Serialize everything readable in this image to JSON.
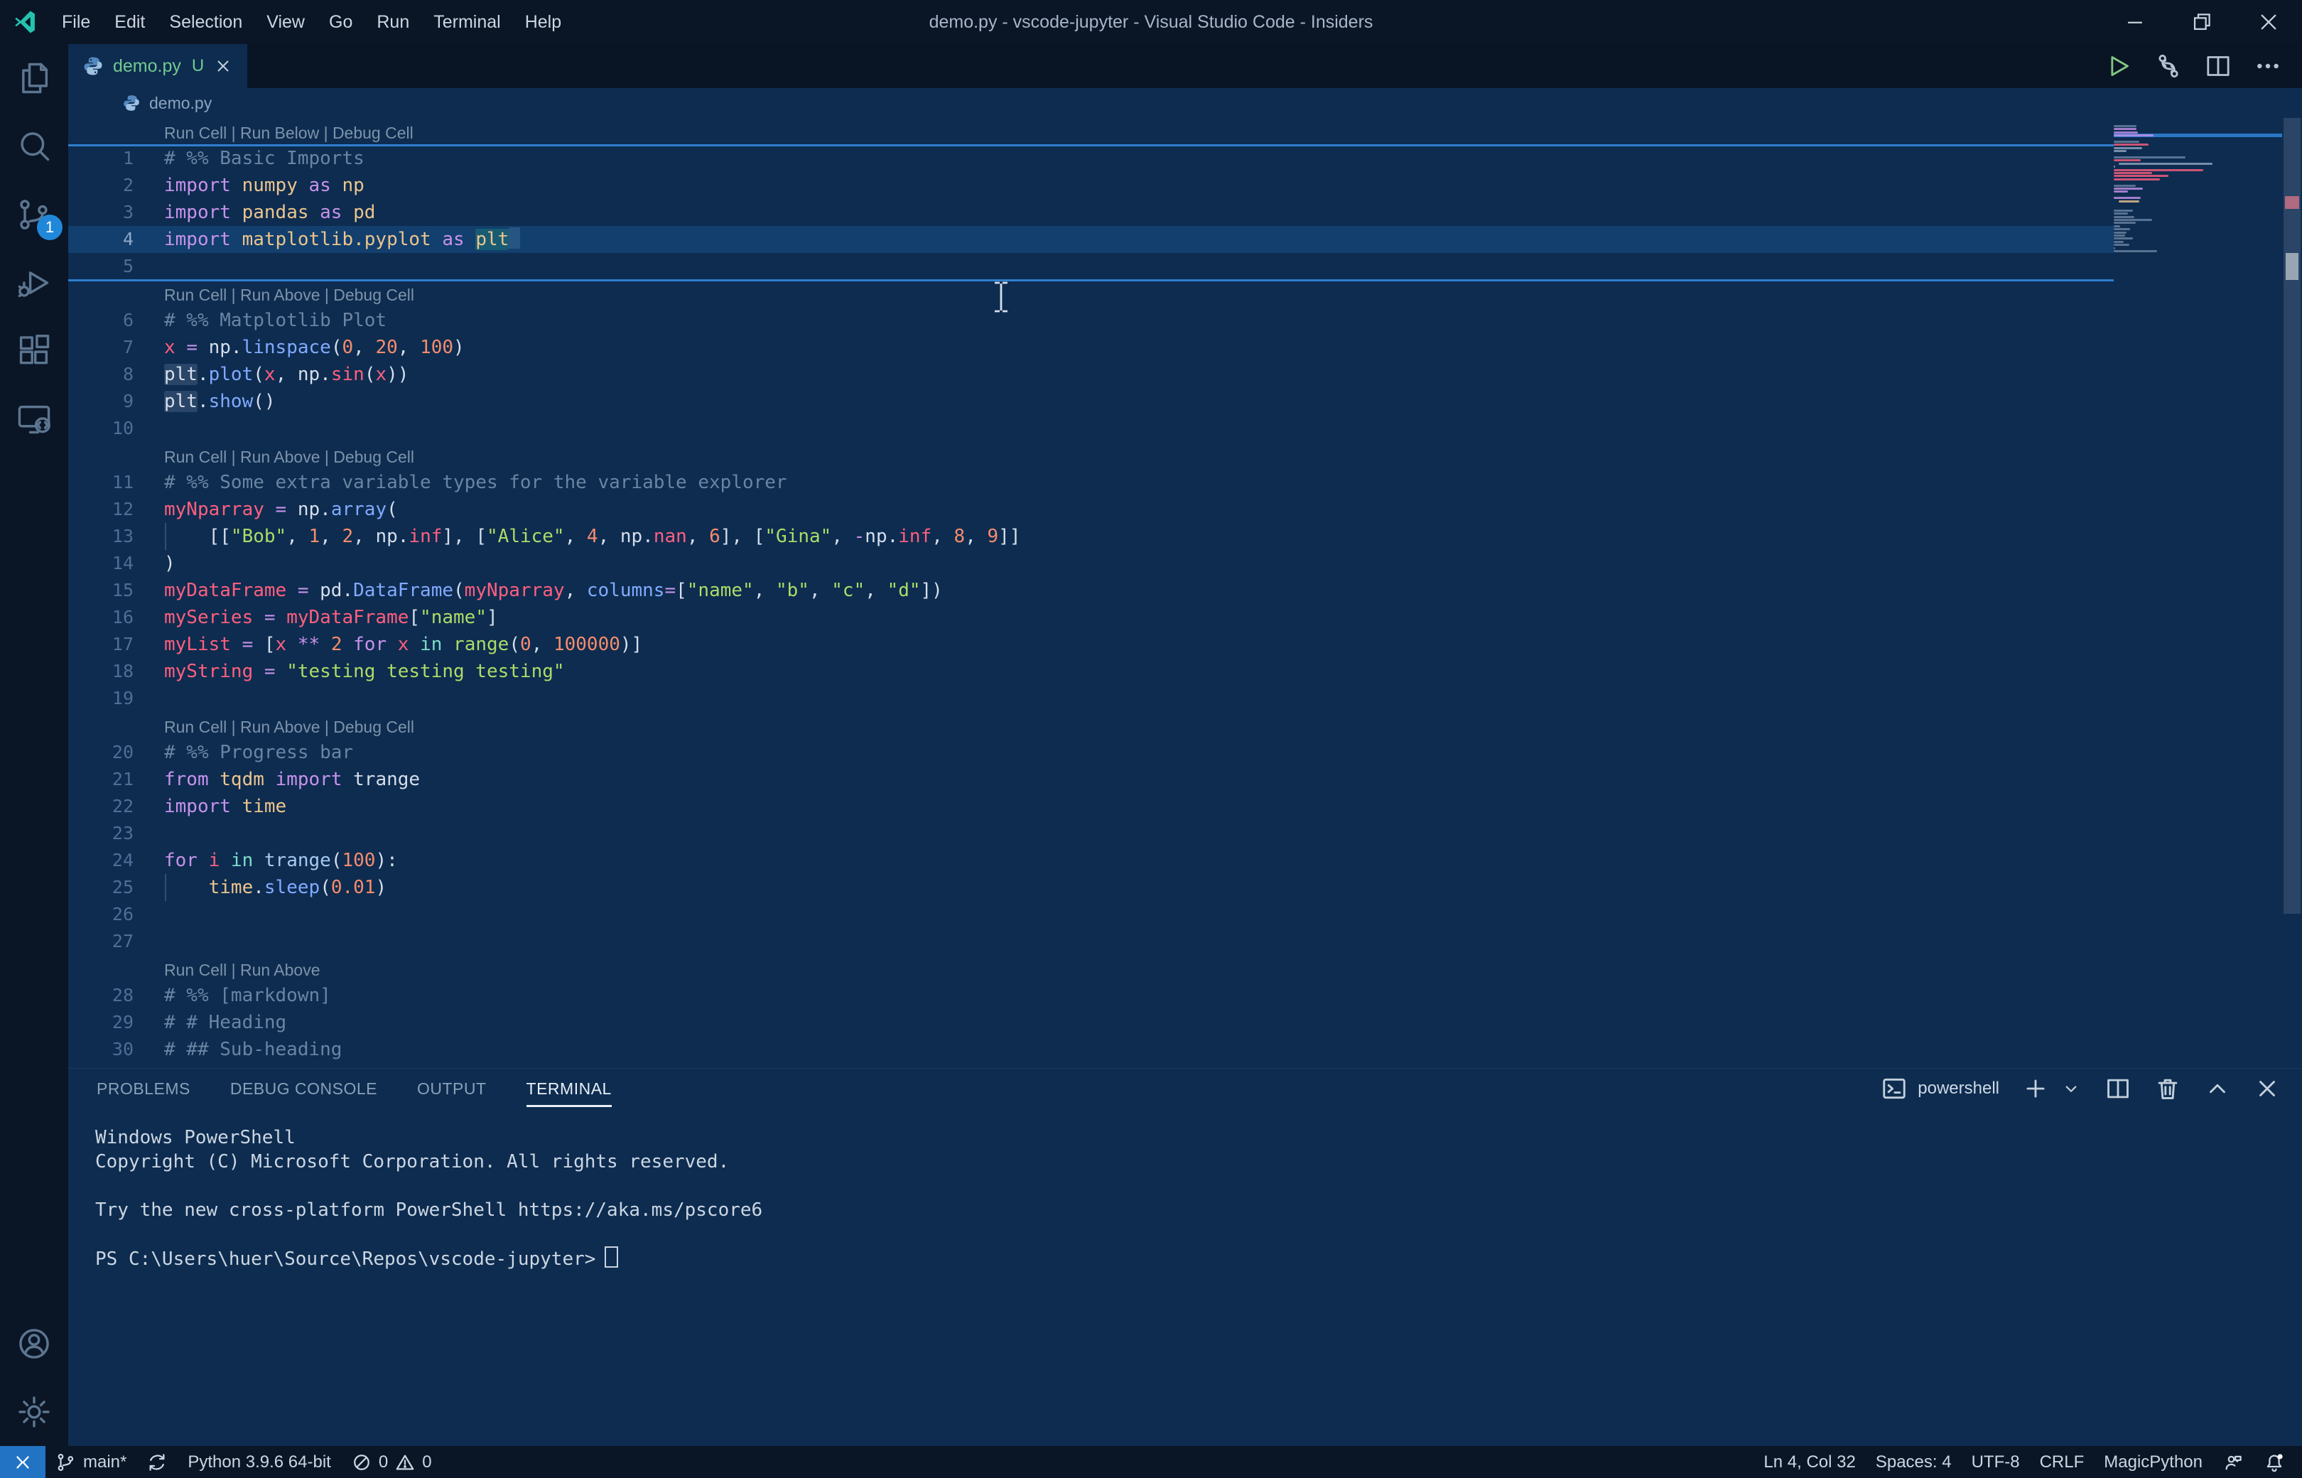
{
  "window": {
    "title": "demo.py - vscode-jupyter - Visual Studio Code - Insiders",
    "menus": [
      "File",
      "Edit",
      "Selection",
      "View",
      "Go",
      "Run",
      "Terminal",
      "Help"
    ]
  },
  "activity_bar": {
    "source_control_badge": "1"
  },
  "editor_tabs": {
    "active_tab": {
      "label": "demo.py",
      "modified_indicator": "U"
    }
  },
  "breadcrumb": {
    "file": "demo.py"
  },
  "editor": {
    "rows": [
      {
        "type": "lens",
        "text": "Run Cell | Run Below | Debug Cell"
      },
      {
        "type": "divider"
      },
      {
        "type": "code",
        "num": "1",
        "tokens": [
          [
            "cm",
            "# %% Basic Imports"
          ]
        ]
      },
      {
        "type": "code",
        "num": "2",
        "tokens": [
          [
            "kw",
            "import"
          ],
          [
            "pl",
            " "
          ],
          [
            "md",
            "numpy"
          ],
          [
            "pl",
            " "
          ],
          [
            "kw",
            "as"
          ],
          [
            "pl",
            " "
          ],
          [
            "md",
            "np"
          ]
        ]
      },
      {
        "type": "code",
        "num": "3",
        "tokens": [
          [
            "kw",
            "import"
          ],
          [
            "pl",
            " "
          ],
          [
            "md",
            "pandas"
          ],
          [
            "pl",
            " "
          ],
          [
            "kw",
            "as"
          ],
          [
            "pl",
            " "
          ],
          [
            "md",
            "pd"
          ]
        ]
      },
      {
        "type": "code",
        "num": "4",
        "hl": true,
        "tokens": [
          [
            "kw",
            "import"
          ],
          [
            "pl",
            " "
          ],
          [
            "md",
            "matplotlib.pyplot"
          ],
          [
            "pl",
            " "
          ],
          [
            "kw",
            "as"
          ],
          [
            "pl",
            " "
          ],
          [
            "md sel",
            "plt"
          ],
          [
            "cur",
            ""
          ]
        ]
      },
      {
        "type": "code",
        "num": "5",
        "tokens": []
      },
      {
        "type": "divider"
      },
      {
        "type": "lens",
        "text": "Run Cell | Run Above | Debug Cell"
      },
      {
        "type": "code",
        "num": "6",
        "tokens": [
          [
            "cm",
            "# %% Matplotlib Plot"
          ]
        ]
      },
      {
        "type": "code",
        "num": "7",
        "tokens": [
          [
            "vr",
            "x"
          ],
          [
            "pl",
            " "
          ],
          [
            "kw",
            "="
          ],
          [
            "pl",
            " np."
          ],
          [
            "fn",
            "linspace"
          ],
          [
            "pl",
            "("
          ],
          [
            "nm",
            "0"
          ],
          [
            "pl",
            ", "
          ],
          [
            "nm",
            "20"
          ],
          [
            "pl",
            ", "
          ],
          [
            "nm",
            "100"
          ],
          [
            "pl",
            ")"
          ]
        ]
      },
      {
        "type": "code",
        "num": "8",
        "tokens": [
          [
            "pl occ",
            "plt"
          ],
          [
            "pl",
            "."
          ],
          [
            "fn",
            "plot"
          ],
          [
            "pl",
            "("
          ],
          [
            "vr",
            "x"
          ],
          [
            "pl",
            ", np."
          ],
          [
            "vr",
            "sin"
          ],
          [
            "pl",
            "("
          ],
          [
            "vr",
            "x"
          ],
          [
            "pl",
            "))"
          ]
        ]
      },
      {
        "type": "code",
        "num": "9",
        "tokens": [
          [
            "pl occ",
            "plt"
          ],
          [
            "pl",
            "."
          ],
          [
            "fn",
            "show"
          ],
          [
            "pl",
            "()"
          ]
        ]
      },
      {
        "type": "code",
        "num": "10",
        "tokens": []
      },
      {
        "type": "lens",
        "text": "Run Cell | Run Above | Debug Cell"
      },
      {
        "type": "code",
        "num": "11",
        "tokens": [
          [
            "cm",
            "# %% Some extra variable types for the variable explorer"
          ]
        ]
      },
      {
        "type": "code",
        "num": "12",
        "tokens": [
          [
            "vr",
            "myNparray"
          ],
          [
            "pl",
            " "
          ],
          [
            "kw",
            "="
          ],
          [
            "pl",
            " np."
          ],
          [
            "fn",
            "array"
          ],
          [
            "pl",
            "("
          ]
        ]
      },
      {
        "type": "code",
        "num": "13",
        "guide": true,
        "tokens": [
          [
            "pl",
            "    [["
          ],
          [
            "st",
            "\"Bob\""
          ],
          [
            "pl",
            ", "
          ],
          [
            "nm",
            "1"
          ],
          [
            "pl",
            ", "
          ],
          [
            "nm",
            "2"
          ],
          [
            "pl",
            ", np."
          ],
          [
            "vr",
            "inf"
          ],
          [
            "pl",
            "], ["
          ],
          [
            "st",
            "\"Alice\""
          ],
          [
            "pl",
            ", "
          ],
          [
            "nm",
            "4"
          ],
          [
            "pl",
            ", np."
          ],
          [
            "vr",
            "nan"
          ],
          [
            "pl",
            ", "
          ],
          [
            "nm",
            "6"
          ],
          [
            "pl",
            "], ["
          ],
          [
            "st",
            "\"Gina\""
          ],
          [
            "pl",
            ", "
          ],
          [
            "kw",
            "-"
          ],
          [
            "pl",
            "np."
          ],
          [
            "vr",
            "inf"
          ],
          [
            "pl",
            ", "
          ],
          [
            "nm",
            "8"
          ],
          [
            "pl",
            ", "
          ],
          [
            "nm",
            "9"
          ],
          [
            "pl",
            "]]"
          ]
        ]
      },
      {
        "type": "code",
        "num": "14",
        "tokens": [
          [
            "pl",
            ")"
          ]
        ]
      },
      {
        "type": "code",
        "num": "15",
        "tokens": [
          [
            "vr",
            "myDataFrame"
          ],
          [
            "pl",
            " "
          ],
          [
            "kw",
            "="
          ],
          [
            "pl",
            " pd."
          ],
          [
            "fn",
            "DataFrame"
          ],
          [
            "pl",
            "("
          ],
          [
            "vr",
            "myNparray"
          ],
          [
            "pl",
            ", "
          ],
          [
            "fn",
            "columns"
          ],
          [
            "kw",
            "="
          ],
          [
            "pl",
            "["
          ],
          [
            "st",
            "\"name\""
          ],
          [
            "pl",
            ", "
          ],
          [
            "st",
            "\"b\""
          ],
          [
            "pl",
            ", "
          ],
          [
            "st",
            "\"c\""
          ],
          [
            "pl",
            ", "
          ],
          [
            "st",
            "\"d\""
          ],
          [
            "pl",
            "])"
          ]
        ]
      },
      {
        "type": "code",
        "num": "16",
        "tokens": [
          [
            "vr",
            "mySeries"
          ],
          [
            "pl",
            " "
          ],
          [
            "kw",
            "="
          ],
          [
            "pl",
            " "
          ],
          [
            "vr",
            "myDataFrame"
          ],
          [
            "pl",
            "["
          ],
          [
            "st",
            "\"name\""
          ],
          [
            "pl",
            "]"
          ]
        ]
      },
      {
        "type": "code",
        "num": "17",
        "tokens": [
          [
            "vr",
            "myList"
          ],
          [
            "pl",
            " "
          ],
          [
            "kw",
            "="
          ],
          [
            "pl",
            " ["
          ],
          [
            "vr",
            "x"
          ],
          [
            "pl",
            " "
          ],
          [
            "kw",
            "**"
          ],
          [
            "pl",
            " "
          ],
          [
            "nm",
            "2"
          ],
          [
            "pl",
            " "
          ],
          [
            "kw",
            "for"
          ],
          [
            "pl",
            " "
          ],
          [
            "vr",
            "x"
          ],
          [
            "pl",
            " "
          ],
          [
            "cy",
            "in"
          ],
          [
            "pl",
            " "
          ],
          [
            "bi",
            "range"
          ],
          [
            "pl",
            "("
          ],
          [
            "nm",
            "0"
          ],
          [
            "pl",
            ", "
          ],
          [
            "nm",
            "100000"
          ],
          [
            "pl",
            ")]"
          ]
        ]
      },
      {
        "type": "code",
        "num": "18",
        "tokens": [
          [
            "vr",
            "myString"
          ],
          [
            "pl",
            " "
          ],
          [
            "kw",
            "="
          ],
          [
            "pl",
            " "
          ],
          [
            "st",
            "\"testing testing testing\""
          ]
        ]
      },
      {
        "type": "code",
        "num": "19",
        "tokens": []
      },
      {
        "type": "lens",
        "text": "Run Cell | Run Above | Debug Cell"
      },
      {
        "type": "code",
        "num": "20",
        "tokens": [
          [
            "cm",
            "# %% Progress bar"
          ]
        ]
      },
      {
        "type": "code",
        "num": "21",
        "tokens": [
          [
            "kw",
            "from"
          ],
          [
            "pl",
            " "
          ],
          [
            "md",
            "tqdm"
          ],
          [
            "pl",
            " "
          ],
          [
            "kw",
            "import"
          ],
          [
            "pl",
            " "
          ],
          [
            "pl",
            "trange"
          ]
        ]
      },
      {
        "type": "code",
        "num": "22",
        "tokens": [
          [
            "kw",
            "import"
          ],
          [
            "pl",
            " "
          ],
          [
            "md",
            "time"
          ]
        ]
      },
      {
        "type": "code",
        "num": "23",
        "tokens": []
      },
      {
        "type": "code",
        "num": "24",
        "tokens": [
          [
            "kw",
            "for"
          ],
          [
            "pl",
            " "
          ],
          [
            "vr",
            "i"
          ],
          [
            "pl",
            " "
          ],
          [
            "cy",
            "in"
          ],
          [
            "pl",
            " "
          ],
          [
            "ic",
            "trange"
          ],
          [
            "pl",
            "("
          ],
          [
            "nm",
            "100"
          ],
          [
            "pl",
            "):"
          ]
        ]
      },
      {
        "type": "code",
        "num": "25",
        "guide": true,
        "tokens": [
          [
            "pl",
            "    "
          ],
          [
            "md",
            "time"
          ],
          [
            "pl",
            "."
          ],
          [
            "fn",
            "sleep"
          ],
          [
            "pl",
            "("
          ],
          [
            "nm",
            "0.01"
          ],
          [
            "pl",
            ")"
          ]
        ]
      },
      {
        "type": "code",
        "num": "26",
        "tokens": []
      },
      {
        "type": "code",
        "num": "27",
        "tokens": []
      },
      {
        "type": "lens",
        "text": "Run Cell | Run Above"
      },
      {
        "type": "code",
        "num": "28",
        "tokens": [
          [
            "cm",
            "# %% [markdown]"
          ]
        ]
      },
      {
        "type": "code",
        "num": "29",
        "tokens": [
          [
            "cm",
            "# # Heading"
          ]
        ]
      },
      {
        "type": "code",
        "num": "30",
        "tokens": [
          [
            "cm",
            "# ## Sub-heading"
          ]
        ]
      }
    ],
    "minimap_extra_line_lengths": [
      30,
      17,
      5,
      13,
      10,
      9,
      15,
      8,
      12,
      1,
      34
    ]
  },
  "panel": {
    "tabs": [
      "PROBLEMS",
      "DEBUG CONSOLE",
      "OUTPUT",
      "TERMINAL"
    ],
    "active_tab": "TERMINAL",
    "shell_label": "powershell",
    "terminal_lines": [
      "Windows PowerShell",
      "Copyright (C) Microsoft Corporation. All rights reserved.",
      "",
      "Try the new cross-platform PowerShell https://aka.ms/pscore6",
      "",
      "PS C:\\Users\\huer\\Source\\Repos\\vscode-jupyter>"
    ]
  },
  "status_bar": {
    "branch": "main*",
    "interpreter": "Python 3.9.6 64-bit",
    "errors": "0",
    "warnings": "0",
    "line_col": "Ln 4, Col 32",
    "indentation": "Spaces: 4",
    "encoding": "UTF-8",
    "eol": "CRLF",
    "language": "MagicPython"
  },
  "colors": {
    "cell_divider": "#2f80d0",
    "badge": "#2188d9",
    "remote_item": "#2273c4",
    "modified_tab_label": "#73c991",
    "editor_background": "#0d2c50",
    "chrome_background": "#0a1526"
  }
}
